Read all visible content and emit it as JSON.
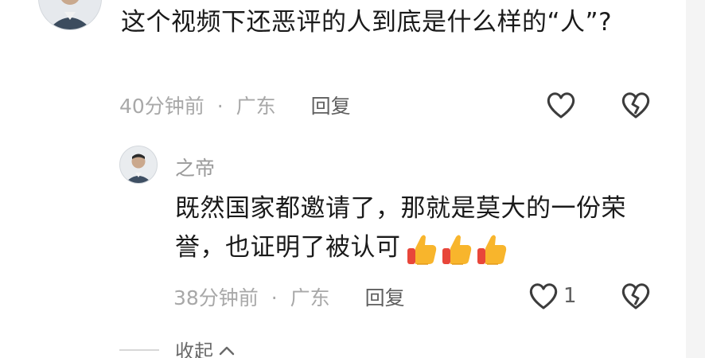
{
  "main_comment": {
    "text": "这个视频下还恶评的人到底是什么样的“人”?",
    "time": "40分钟前",
    "separator": "·",
    "location": "广东",
    "reply_label": "回复"
  },
  "reply_comment": {
    "username": "之帝",
    "text": "既然国家都邀请了，那就是莫大的一份荣誉，也证明了被认可",
    "emoji_icon": "thumbs-up-icon",
    "emoji_count": 3,
    "time": "38分钟前",
    "separator": "·",
    "location": "广东",
    "reply_label": "回复",
    "like_count": "1"
  },
  "collapse": {
    "label": "收起"
  },
  "colors": {
    "text": "#1a1a1a",
    "meta": "#a8a8a8",
    "icon": "#3c3c3c",
    "sidebar": "#f4f4f4"
  }
}
